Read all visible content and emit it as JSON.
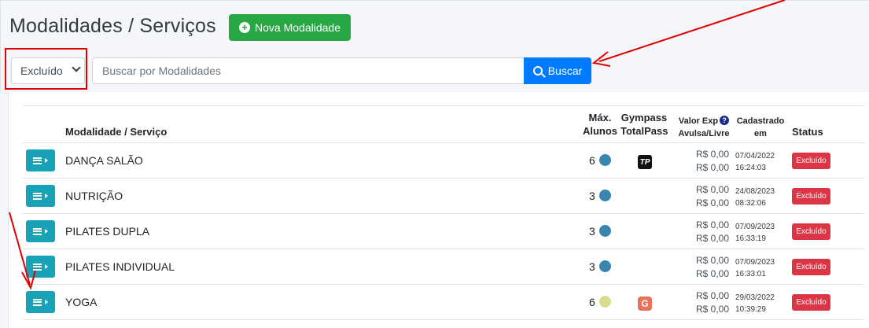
{
  "header": {
    "title": "Modalidades / Serviços",
    "new_button": "Nova Modalidade"
  },
  "filters": {
    "status_selected": "Excluído",
    "search_placeholder": "Buscar por Modalidades",
    "search_button": "Buscar"
  },
  "table": {
    "columns": {
      "name": "Modalidade / Serviço",
      "max_line1": "Máx.",
      "max_line2": "Alunos",
      "gym_line1": "Gympass",
      "gym_line2": "TotalPass",
      "valor_line1": "Valor Exp",
      "valor_line2": "Avulsa/Livre",
      "cad_line1": "Cadastrado",
      "cad_line2": "em",
      "status": "Status"
    },
    "rows": [
      {
        "name": "DANÇA SALÃO",
        "max": "6",
        "dot_color": "#3a84b0",
        "partner": "TP",
        "price1": "R$ 0,00",
        "price2": "R$ 0,00",
        "date": "07/04/2022",
        "time": "16:24:03",
        "status": "Excluído"
      },
      {
        "name": "NUTRIÇÃO",
        "max": "3",
        "dot_color": "#3a84b0",
        "partner": "",
        "price1": "R$ 0,00",
        "price2": "R$ 0,00",
        "date": "24/08/2023",
        "time": "08:32:06",
        "status": "Excluído"
      },
      {
        "name": "PILATES DUPLA",
        "max": "3",
        "dot_color": "#3a84b0",
        "partner": "",
        "price1": "R$ 0,00",
        "price2": "R$ 0,00",
        "date": "07/09/2023",
        "time": "16:33:19",
        "status": "Excluído"
      },
      {
        "name": "PILATES INDIVIDUAL",
        "max": "3",
        "dot_color": "#3a84b0",
        "partner": "",
        "price1": "R$ 0,00",
        "price2": "R$ 0,00",
        "date": "07/09/2023",
        "time": "16:33:01",
        "status": "Excluído"
      },
      {
        "name": "YOGA",
        "max": "6",
        "dot_color": "#d9dc8e",
        "partner": "G",
        "price1": "R$ 0,00",
        "price2": "R$ 0,00",
        "date": "29/03/2022",
        "time": "10:39:29",
        "status": "Excluído"
      }
    ]
  },
  "colors": {
    "primary": "#007bff",
    "success": "#28a745",
    "info": "#17a2b8",
    "danger": "#dc3545",
    "annotation": "#e00000"
  }
}
